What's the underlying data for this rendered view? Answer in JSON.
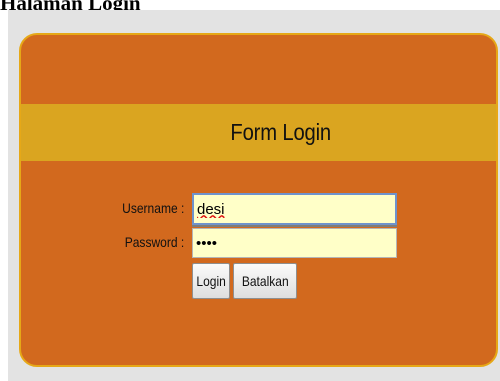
{
  "document_heading": "Halaman Login",
  "form": {
    "title": "Form Login",
    "username": {
      "label": "Username :",
      "value": "desi"
    },
    "password": {
      "label": "Password  :",
      "value": "••••"
    },
    "buttons": {
      "login": "Login",
      "cancel": "Batalkan"
    }
  },
  "colors": {
    "panel_background": "#d2691e",
    "title_band": "#daa520",
    "panel_border": "#e6a817",
    "input_background": "#ffffc8",
    "page_background": "#e3e3e3"
  }
}
